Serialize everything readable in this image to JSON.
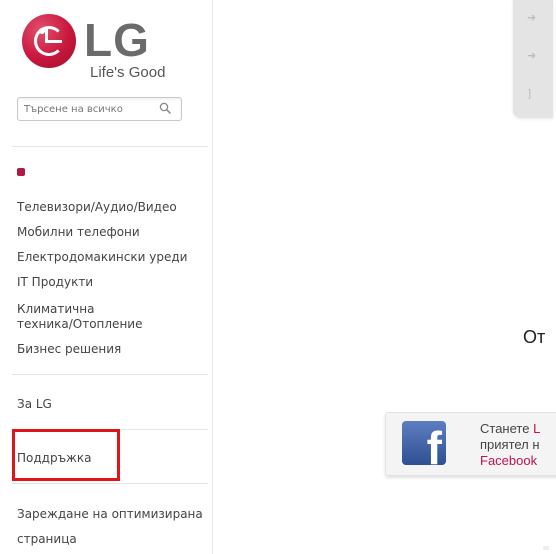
{
  "brand": {
    "logo_text": "LG",
    "slogan": "Life's Good",
    "accent_color": "#c8173c"
  },
  "search": {
    "placeholder": "Търсене на всичко",
    "icon": "search-icon"
  },
  "nav": {
    "products": [
      "Телевизори/Аудио/Видео",
      "Мобилни телефони",
      "Електродомакински уреди",
      "IT Продукти"
    ],
    "climate_line1": "Климатична",
    "climate_line2": "техника/Отопление",
    "business": "Бизнес решения",
    "about": "За LG",
    "support": "Поддръжка",
    "optimized_line1": "Зареждане на оптимизирана",
    "optimized_line2": "страница"
  },
  "main": {
    "partial_heading": "От",
    "facebook": {
      "line1_prefix": "Станете ",
      "line1_accent": "L",
      "line2": "приятел н",
      "line3": "Facebook"
    }
  }
}
